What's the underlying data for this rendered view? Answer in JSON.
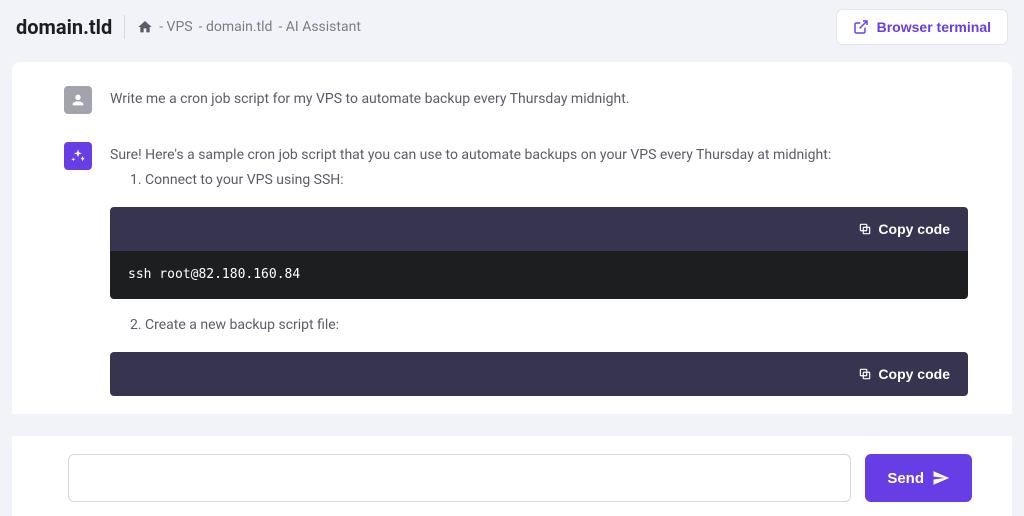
{
  "header": {
    "title": "domain.tld",
    "breadcrumb": {
      "part1": "- VPS",
      "part2": "- domain.tld",
      "part3": "- AI Assistant"
    },
    "terminal_button": "Browser terminal"
  },
  "chat": {
    "user_message": "Write me a cron job script for my VPS to automate backup every Thursday midnight.",
    "assistant": {
      "intro": "Sure! Here's a sample cron job script that you can use to automate backups on your VPS every Thursday at midnight:",
      "step1": "1. Connect to your VPS using SSH:",
      "code1": "ssh root@82.180.160.84",
      "step2": "2. Create a new backup script file:",
      "copy_label": "Copy code"
    }
  },
  "input": {
    "send_label": "Send",
    "placeholder": ""
  }
}
